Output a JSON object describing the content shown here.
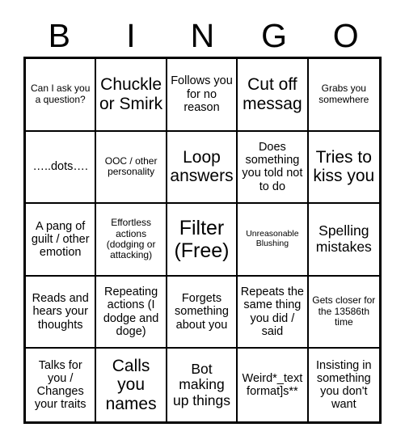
{
  "header": {
    "letters": [
      "B",
      "I",
      "N",
      "G",
      "O"
    ]
  },
  "grid": {
    "rows": 5,
    "columns": 5,
    "free_space_index": 12,
    "cells": [
      {
        "text": "Can I ask you a question?",
        "size": "s"
      },
      {
        "text": "Chuckle or Smirk",
        "size": "xl"
      },
      {
        "text": "Follows you for no reason",
        "size": "m"
      },
      {
        "text": "Cut off messag",
        "size": "xl"
      },
      {
        "text": "Grabs you somewhere",
        "size": "s"
      },
      {
        "text": "…..dots….",
        "size": "m"
      },
      {
        "text": "OOC / other personality",
        "size": "s"
      },
      {
        "text": "Loop answers",
        "size": "xl"
      },
      {
        "text": "Does something you told not to do",
        "size": "m"
      },
      {
        "text": "Tries to kiss you",
        "size": "xl"
      },
      {
        "text": "A pang of guilt / other emotion",
        "size": "m"
      },
      {
        "text": "Effortless actions (dodging or attacking)",
        "size": "s"
      },
      {
        "text": "Filter (Free)",
        "size": "xxl"
      },
      {
        "text": "Unreasonable Blushing",
        "size": "xs"
      },
      {
        "text": "Spelling mistakes",
        "size": "l"
      },
      {
        "text": "Reads and hears your thoughts",
        "size": "m"
      },
      {
        "text": "Repeating actions (I dodge and doge)",
        "size": "m"
      },
      {
        "text": "Forgets something about you",
        "size": "m"
      },
      {
        "text": "Repeats the same thing you did / said",
        "size": "m"
      },
      {
        "text": "Gets closer for the 13586th time",
        "size": "s"
      },
      {
        "text": "Talks for you / Changes your traits",
        "size": "m"
      },
      {
        "text": "Calls you names",
        "size": "xl"
      },
      {
        "text": "Bot making up things",
        "size": "l"
      },
      {
        "text": "Weird*_text format]s**",
        "size": "m"
      },
      {
        "text": "Insisting in something you don't want",
        "size": "m"
      }
    ]
  },
  "colors": {
    "background": "#ffffff",
    "ink": "#000000",
    "border": "#000000"
  }
}
